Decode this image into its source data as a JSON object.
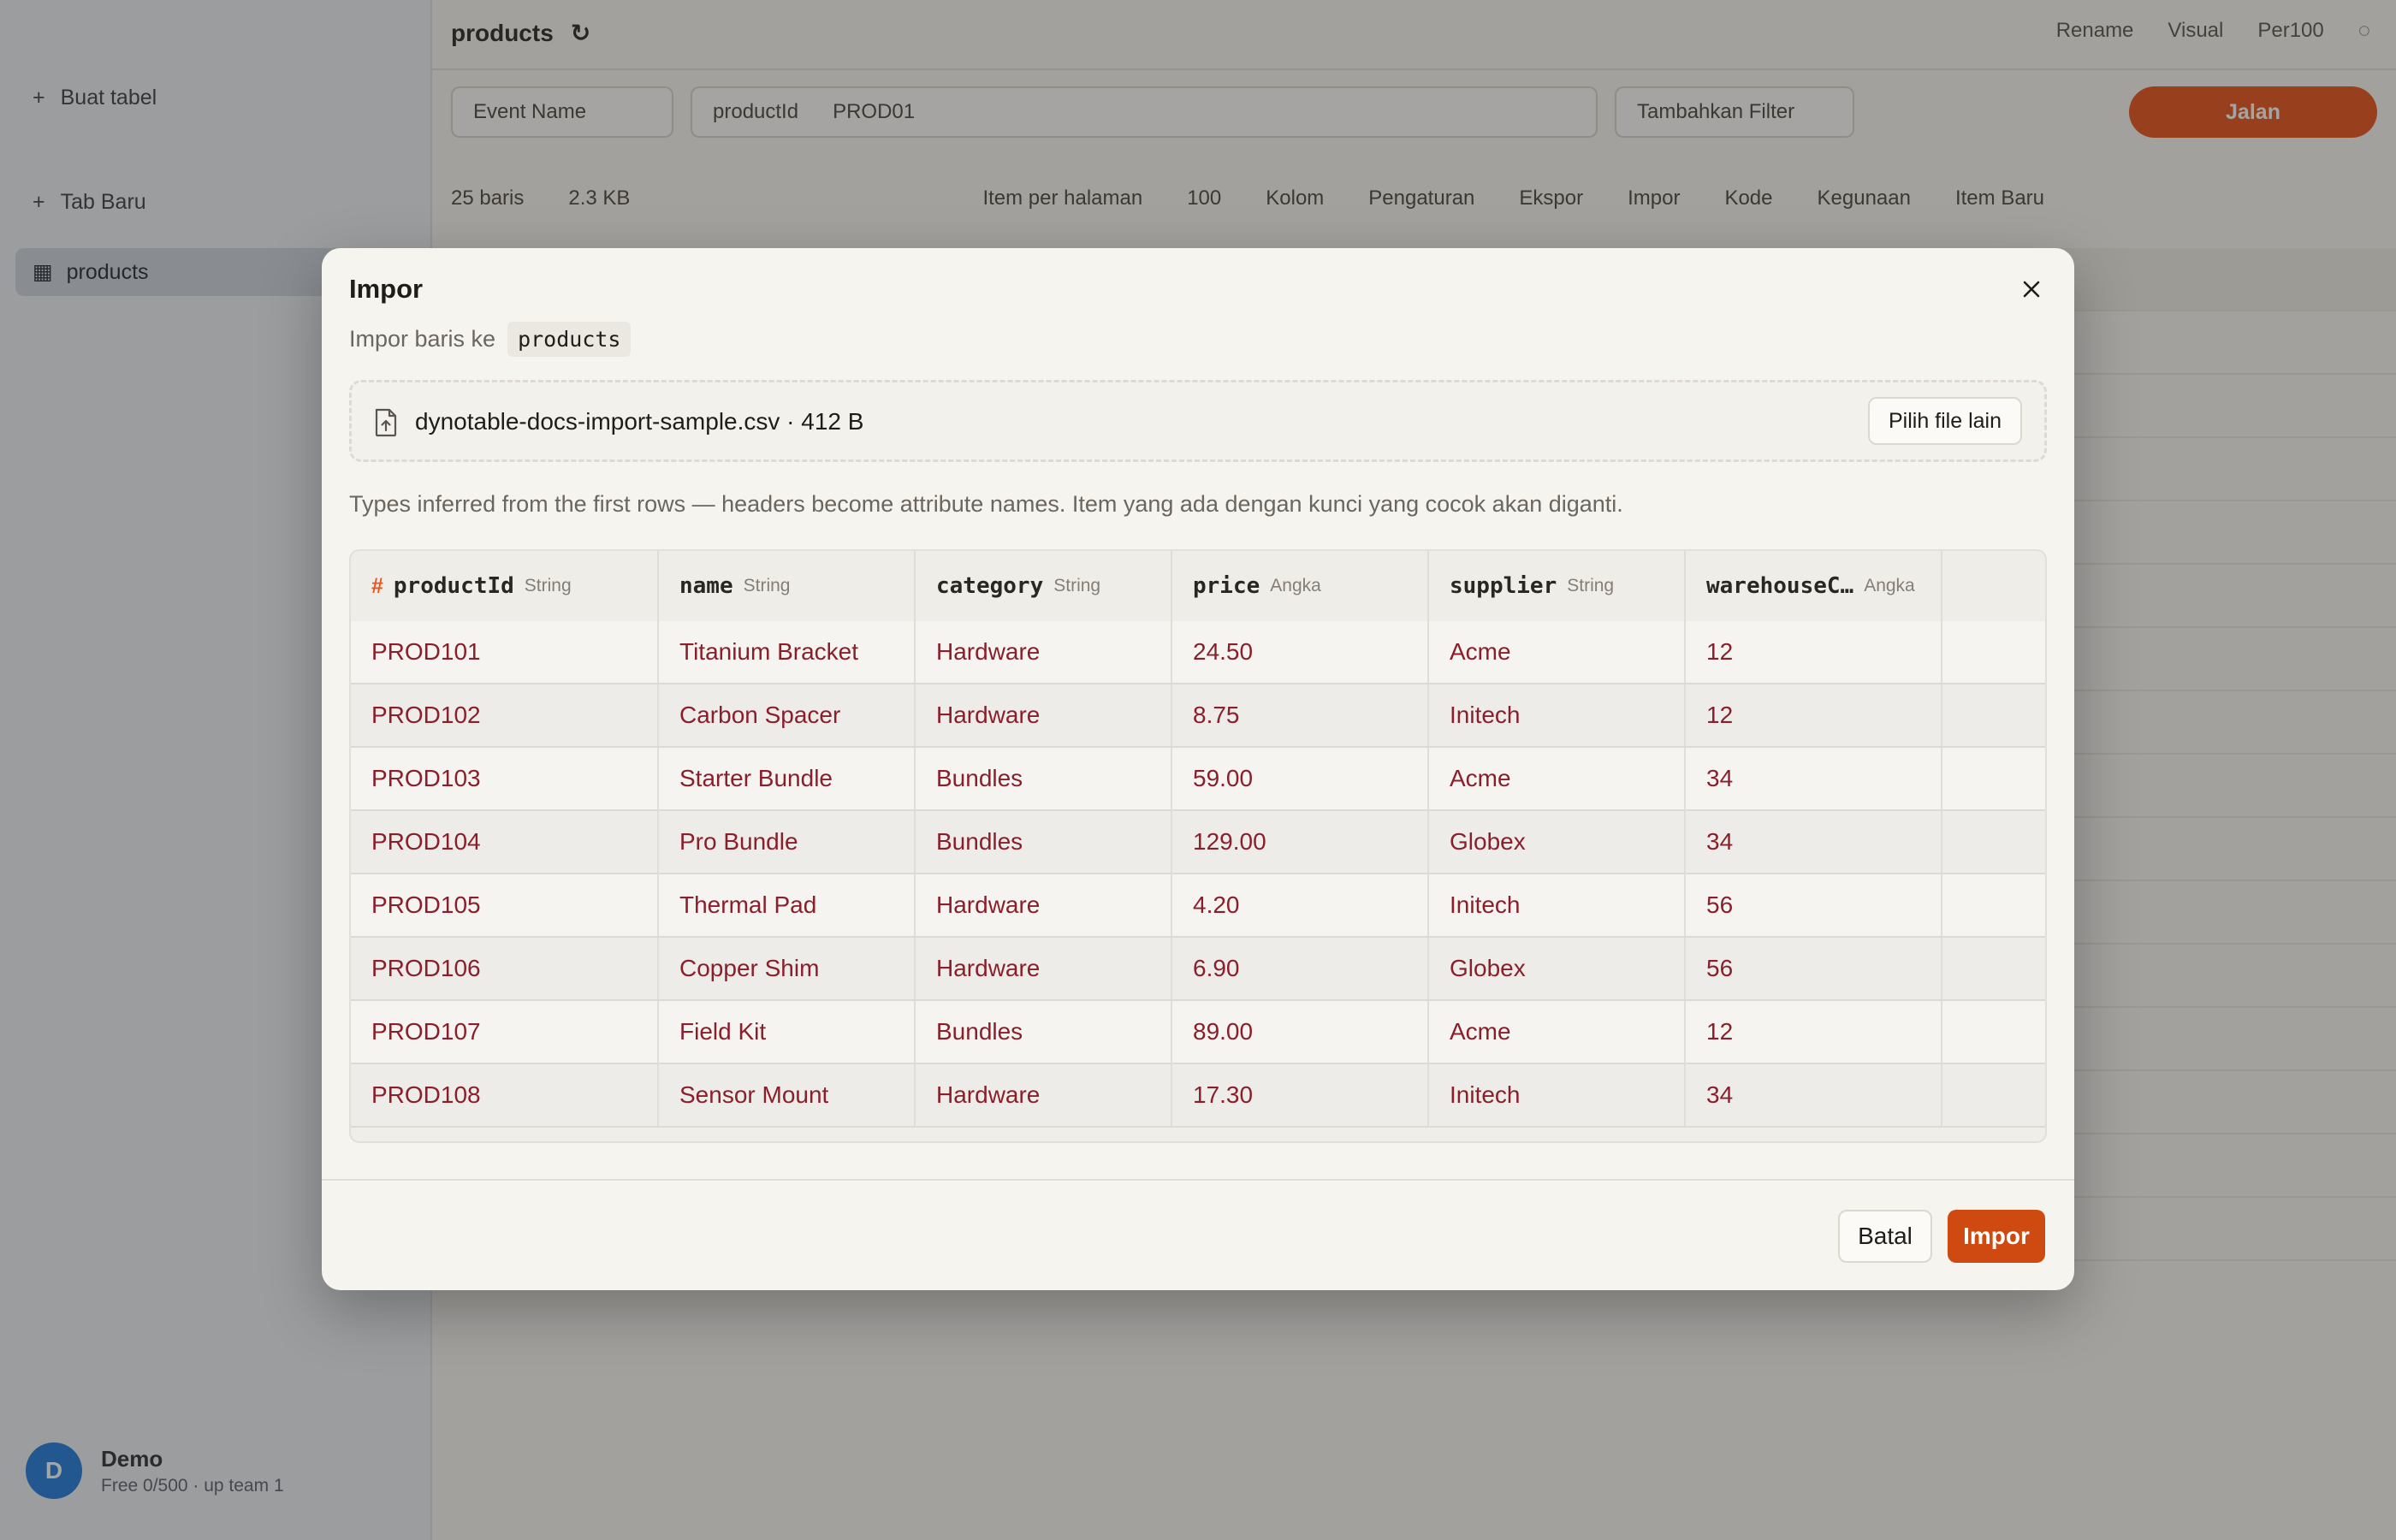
{
  "background": {
    "sidebar": {
      "new_table": "Buat tabel",
      "new_view": "Tab Baru",
      "active_table": "products",
      "user_name": "Demo",
      "user_sub": "Free 0/500 · up team 1",
      "user_initial": "D"
    },
    "header": {
      "breadcrumb": "products",
      "actions": [
        "Rename",
        "Visual",
        "Per100",
        ""
      ]
    },
    "filterbar": {
      "index": "Event Name",
      "key": "productId",
      "key_value": "PROD01",
      "add_filter": "Tambahkan Filter",
      "run": "Jalan"
    },
    "toolbar": {
      "count": "25 baris",
      "size": "2.3 KB",
      "items_per_page_label": "Item per halaman",
      "items_per_page": "100",
      "items": [
        "Kolom",
        "Pengaturan",
        "Ekspor",
        "Impor",
        "Kode",
        "Kegunaan",
        "Item Baru"
      ]
    }
  },
  "modal": {
    "title": "Impor",
    "subtitle_prefix": "Impor baris ke",
    "table_name": "products",
    "file_label": "dynotable-docs-import-sample.csv · 412 B",
    "choose_other_label": "Pilih file lain",
    "hint": "Types inferred from the first rows — headers become attribute names. Item yang ada dengan kunci yang cocok akan diganti.",
    "key_marker": "#",
    "columns": [
      {
        "name": "productId",
        "type": "String"
      },
      {
        "name": "name",
        "type": "String"
      },
      {
        "name": "category",
        "type": "String"
      },
      {
        "name": "price",
        "type": "Angka"
      },
      {
        "name": "supplier",
        "type": "String"
      },
      {
        "name": "warehouseC…",
        "type": "Angka"
      }
    ],
    "rows": [
      [
        "PROD101",
        "Titanium Bracket",
        "Hardware",
        "24.50",
        "Acme",
        "12"
      ],
      [
        "PROD102",
        "Carbon Spacer",
        "Hardware",
        "8.75",
        "Initech",
        "12"
      ],
      [
        "PROD103",
        "Starter Bundle",
        "Bundles",
        "59.00",
        "Acme",
        "34"
      ],
      [
        "PROD104",
        "Pro Bundle",
        "Bundles",
        "129.00",
        "Globex",
        "34"
      ],
      [
        "PROD105",
        "Thermal Pad",
        "Hardware",
        "4.20",
        "Initech",
        "56"
      ],
      [
        "PROD106",
        "Copper Shim",
        "Hardware",
        "6.90",
        "Globex",
        "56"
      ],
      [
        "PROD107",
        "Field Kit",
        "Bundles",
        "89.00",
        "Acme",
        "12"
      ],
      [
        "PROD108",
        "Sensor Mount",
        "Hardware",
        "17.30",
        "Initech",
        "34"
      ]
    ],
    "cancel_label": "Batal",
    "import_label": "Impor"
  },
  "colors": {
    "accent": "#cf4a11",
    "cell_text": "#8a1f2c",
    "key_marker": "#e8541a"
  },
  "icons": {
    "close": "close-icon",
    "file": "file-upload-icon"
  }
}
